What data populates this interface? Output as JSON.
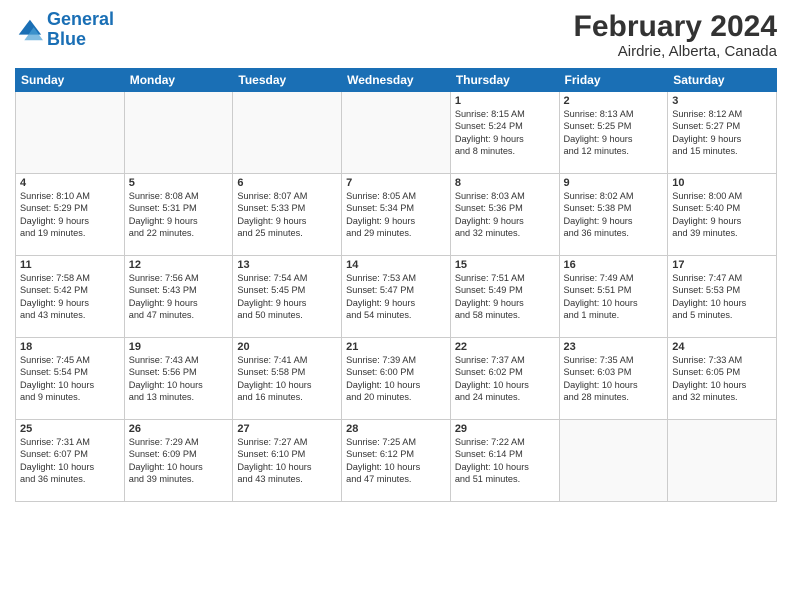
{
  "header": {
    "logo_line1": "General",
    "logo_line2": "Blue",
    "title": "February 2024",
    "subtitle": "Airdrie, Alberta, Canada"
  },
  "days_of_week": [
    "Sunday",
    "Monday",
    "Tuesday",
    "Wednesday",
    "Thursday",
    "Friday",
    "Saturday"
  ],
  "weeks": [
    [
      {
        "day": "",
        "info": ""
      },
      {
        "day": "",
        "info": ""
      },
      {
        "day": "",
        "info": ""
      },
      {
        "day": "",
        "info": ""
      },
      {
        "day": "1",
        "info": "Sunrise: 8:15 AM\nSunset: 5:24 PM\nDaylight: 9 hours\nand 8 minutes."
      },
      {
        "day": "2",
        "info": "Sunrise: 8:13 AM\nSunset: 5:25 PM\nDaylight: 9 hours\nand 12 minutes."
      },
      {
        "day": "3",
        "info": "Sunrise: 8:12 AM\nSunset: 5:27 PM\nDaylight: 9 hours\nand 15 minutes."
      }
    ],
    [
      {
        "day": "4",
        "info": "Sunrise: 8:10 AM\nSunset: 5:29 PM\nDaylight: 9 hours\nand 19 minutes."
      },
      {
        "day": "5",
        "info": "Sunrise: 8:08 AM\nSunset: 5:31 PM\nDaylight: 9 hours\nand 22 minutes."
      },
      {
        "day": "6",
        "info": "Sunrise: 8:07 AM\nSunset: 5:33 PM\nDaylight: 9 hours\nand 25 minutes."
      },
      {
        "day": "7",
        "info": "Sunrise: 8:05 AM\nSunset: 5:34 PM\nDaylight: 9 hours\nand 29 minutes."
      },
      {
        "day": "8",
        "info": "Sunrise: 8:03 AM\nSunset: 5:36 PM\nDaylight: 9 hours\nand 32 minutes."
      },
      {
        "day": "9",
        "info": "Sunrise: 8:02 AM\nSunset: 5:38 PM\nDaylight: 9 hours\nand 36 minutes."
      },
      {
        "day": "10",
        "info": "Sunrise: 8:00 AM\nSunset: 5:40 PM\nDaylight: 9 hours\nand 39 minutes."
      }
    ],
    [
      {
        "day": "11",
        "info": "Sunrise: 7:58 AM\nSunset: 5:42 PM\nDaylight: 9 hours\nand 43 minutes."
      },
      {
        "day": "12",
        "info": "Sunrise: 7:56 AM\nSunset: 5:43 PM\nDaylight: 9 hours\nand 47 minutes."
      },
      {
        "day": "13",
        "info": "Sunrise: 7:54 AM\nSunset: 5:45 PM\nDaylight: 9 hours\nand 50 minutes."
      },
      {
        "day": "14",
        "info": "Sunrise: 7:53 AM\nSunset: 5:47 PM\nDaylight: 9 hours\nand 54 minutes."
      },
      {
        "day": "15",
        "info": "Sunrise: 7:51 AM\nSunset: 5:49 PM\nDaylight: 9 hours\nand 58 minutes."
      },
      {
        "day": "16",
        "info": "Sunrise: 7:49 AM\nSunset: 5:51 PM\nDaylight: 10 hours\nand 1 minute."
      },
      {
        "day": "17",
        "info": "Sunrise: 7:47 AM\nSunset: 5:53 PM\nDaylight: 10 hours\nand 5 minutes."
      }
    ],
    [
      {
        "day": "18",
        "info": "Sunrise: 7:45 AM\nSunset: 5:54 PM\nDaylight: 10 hours\nand 9 minutes."
      },
      {
        "day": "19",
        "info": "Sunrise: 7:43 AM\nSunset: 5:56 PM\nDaylight: 10 hours\nand 13 minutes."
      },
      {
        "day": "20",
        "info": "Sunrise: 7:41 AM\nSunset: 5:58 PM\nDaylight: 10 hours\nand 16 minutes."
      },
      {
        "day": "21",
        "info": "Sunrise: 7:39 AM\nSunset: 6:00 PM\nDaylight: 10 hours\nand 20 minutes."
      },
      {
        "day": "22",
        "info": "Sunrise: 7:37 AM\nSunset: 6:02 PM\nDaylight: 10 hours\nand 24 minutes."
      },
      {
        "day": "23",
        "info": "Sunrise: 7:35 AM\nSunset: 6:03 PM\nDaylight: 10 hours\nand 28 minutes."
      },
      {
        "day": "24",
        "info": "Sunrise: 7:33 AM\nSunset: 6:05 PM\nDaylight: 10 hours\nand 32 minutes."
      }
    ],
    [
      {
        "day": "25",
        "info": "Sunrise: 7:31 AM\nSunset: 6:07 PM\nDaylight: 10 hours\nand 36 minutes."
      },
      {
        "day": "26",
        "info": "Sunrise: 7:29 AM\nSunset: 6:09 PM\nDaylight: 10 hours\nand 39 minutes."
      },
      {
        "day": "27",
        "info": "Sunrise: 7:27 AM\nSunset: 6:10 PM\nDaylight: 10 hours\nand 43 minutes."
      },
      {
        "day": "28",
        "info": "Sunrise: 7:25 AM\nSunset: 6:12 PM\nDaylight: 10 hours\nand 47 minutes."
      },
      {
        "day": "29",
        "info": "Sunrise: 7:22 AM\nSunset: 6:14 PM\nDaylight: 10 hours\nand 51 minutes."
      },
      {
        "day": "",
        "info": ""
      },
      {
        "day": "",
        "info": ""
      }
    ]
  ]
}
